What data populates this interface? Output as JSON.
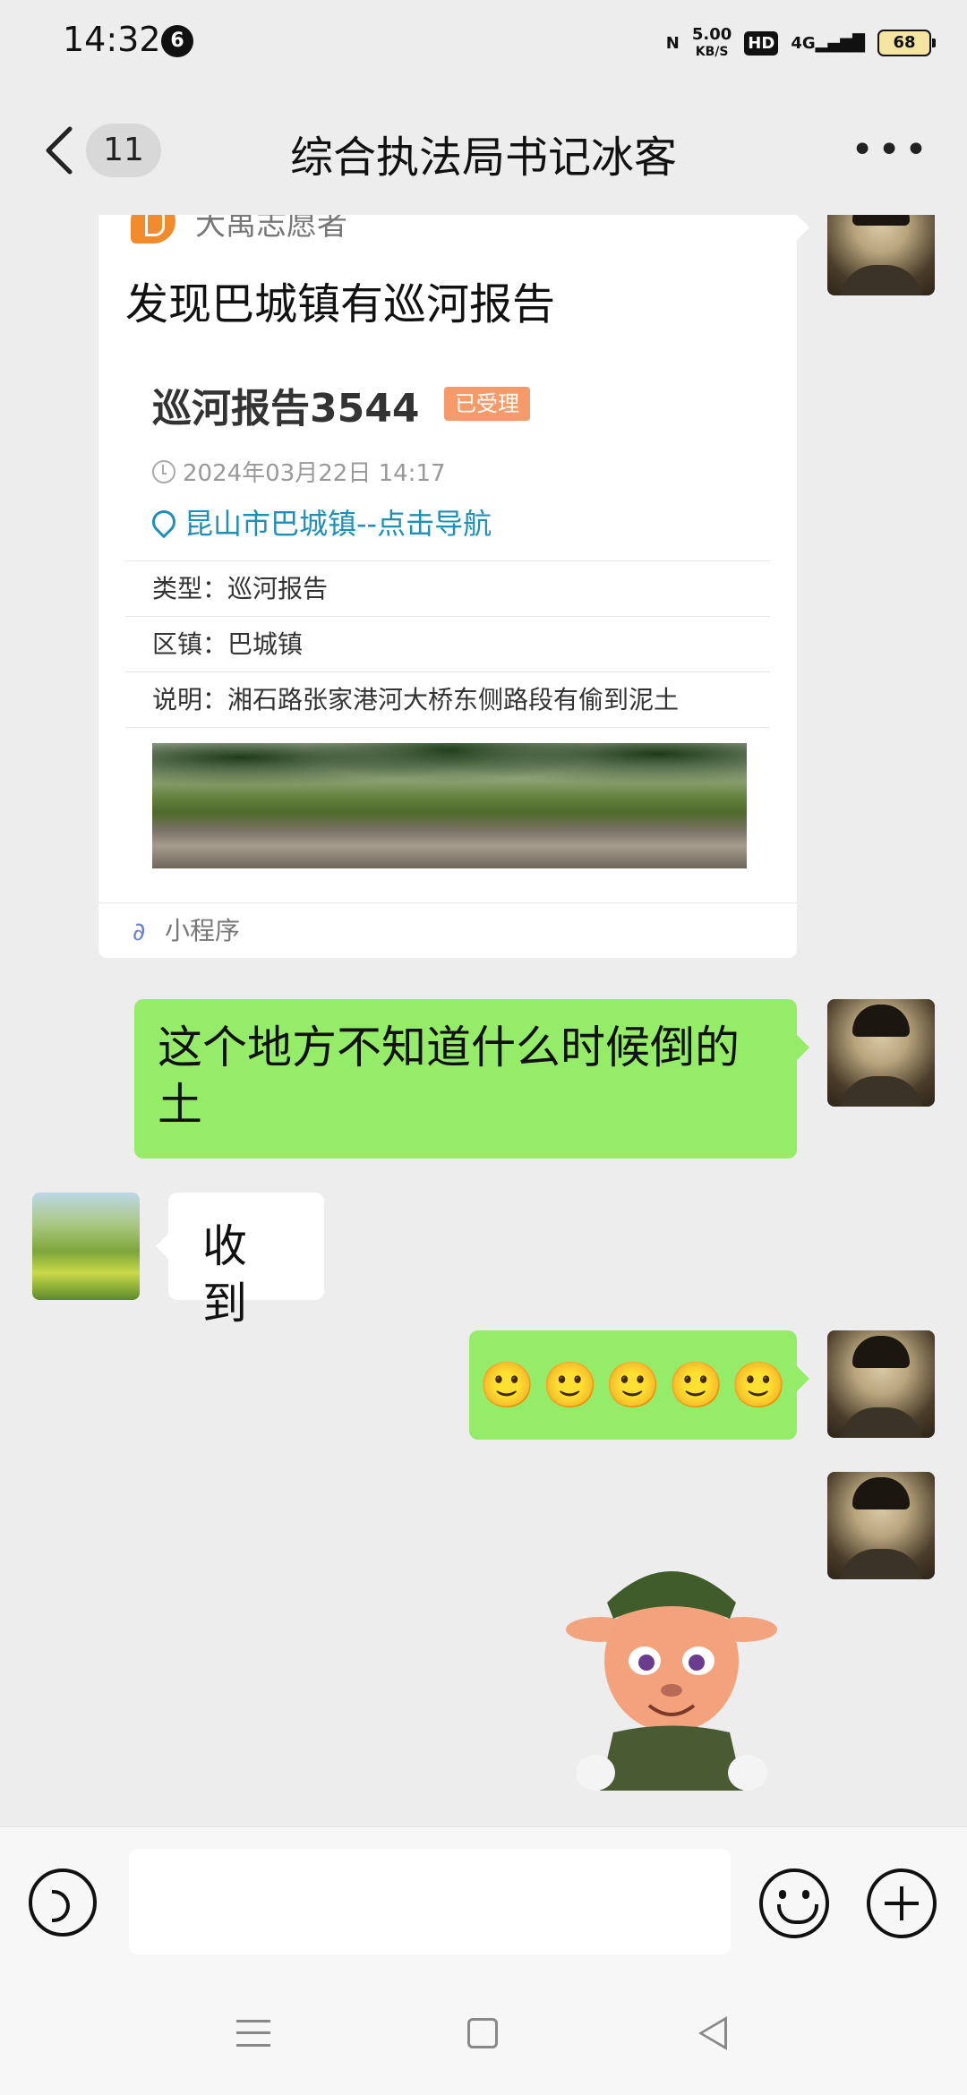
{
  "status_bar": {
    "time": "14:32",
    "notification_count": "6",
    "net_speed_value": "5.00",
    "net_speed_unit": "KB/S",
    "hd_label": "HD",
    "network": "4G",
    "battery": "68"
  },
  "header": {
    "unread_count": "11",
    "title": "综合执法局书记冰客"
  },
  "messages": {
    "card": {
      "source": "大禹志愿者",
      "title": "发现巴城镇有巡河报告",
      "report_name": "巡河报告3544",
      "status_tag": "已受理",
      "report_time": "2024年03月22日 14:17",
      "location": "昆山市巴城镇--点击导航",
      "fields": [
        {
          "text": "类型：巡河报告"
        },
        {
          "text": "区镇：巴城镇"
        },
        {
          "text": "说明：湘石路张家港河大桥东侧路段有偷到泥土"
        }
      ],
      "footer_label": "小程序"
    },
    "text_1": "这个地方不知道什么时候倒的土",
    "text_2": "收到",
    "emoji_row": [
      "🙂",
      "🙂",
      "🙂",
      "🙂",
      "🙂"
    ]
  },
  "icons": {
    "back": "chevron-left-icon",
    "more": "more-icon",
    "voice": "voice-icon",
    "emoji": "emoji-icon",
    "plus": "plus-icon"
  },
  "colors": {
    "sent_bubble": "#95ec69",
    "received_bubble": "#ffffff",
    "background": "#ededed",
    "status_tag": "#f79a6a",
    "link": "#1f8fb8"
  }
}
